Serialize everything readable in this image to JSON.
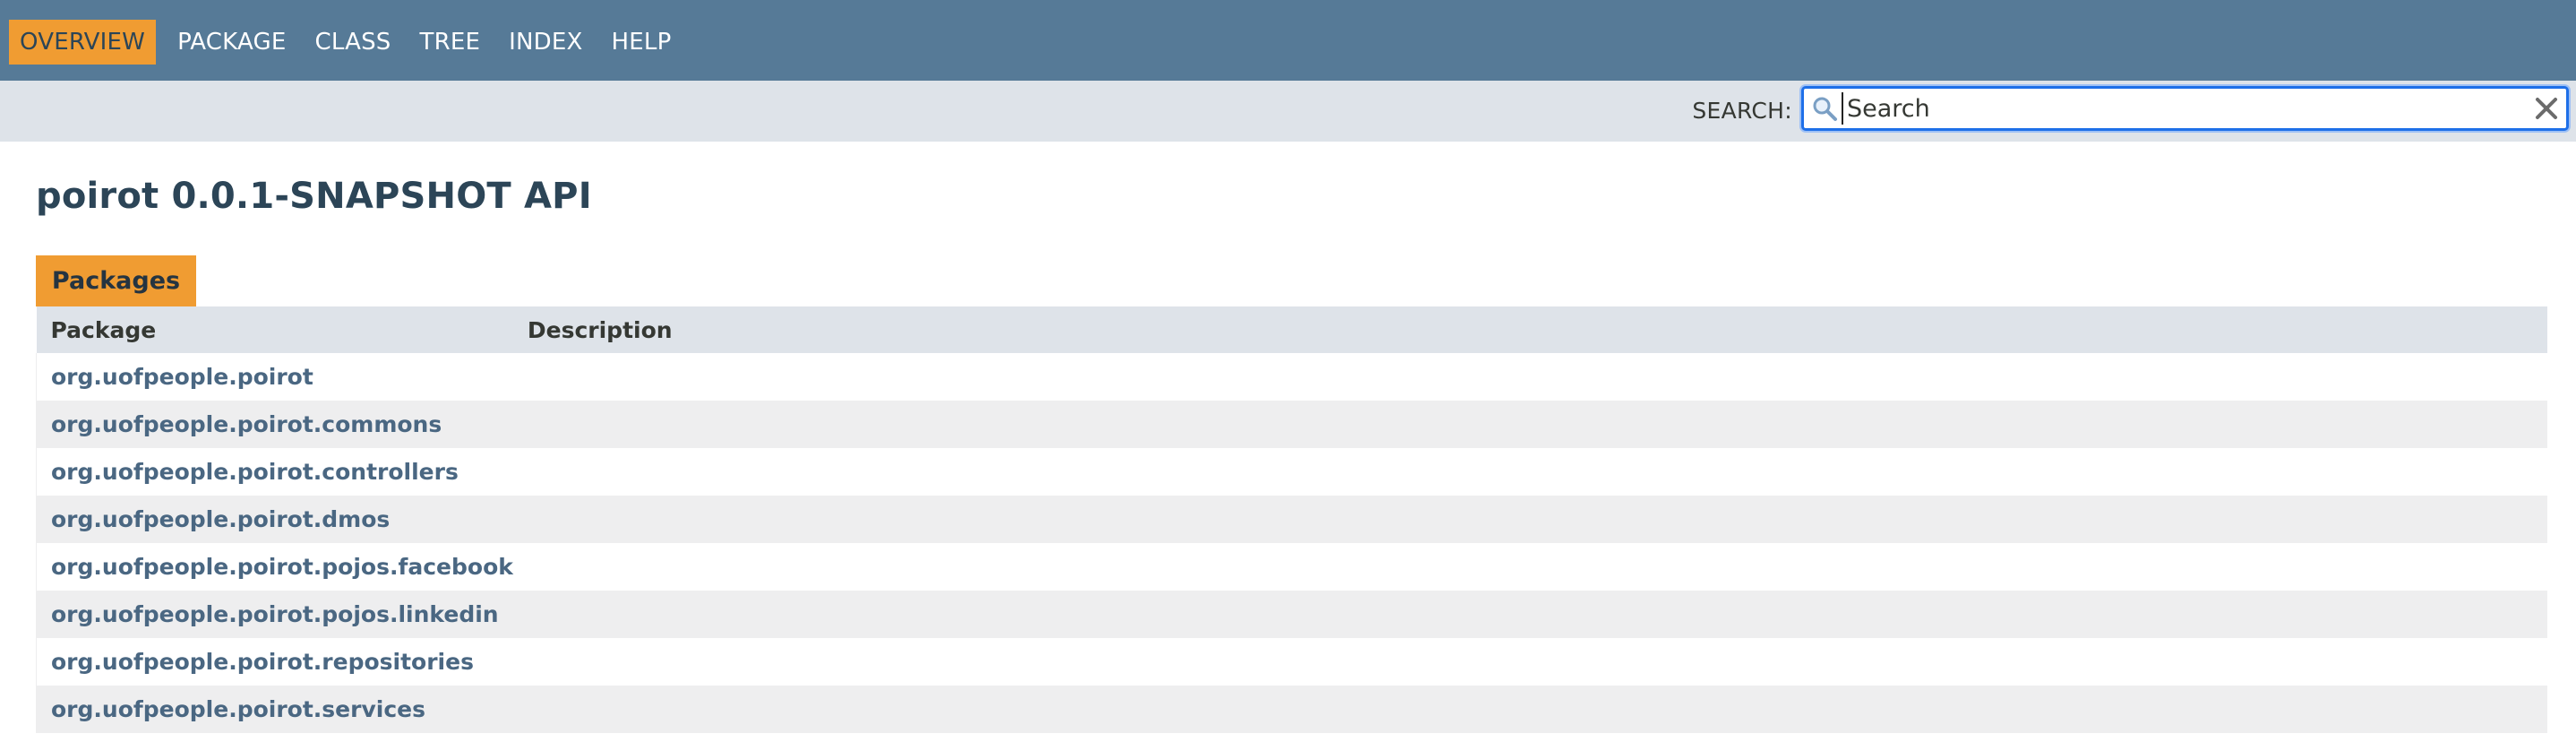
{
  "nav": {
    "items": [
      {
        "label": "OVERVIEW",
        "active": true
      },
      {
        "label": "PACKAGE",
        "active": false
      },
      {
        "label": "CLASS",
        "active": false
      },
      {
        "label": "TREE",
        "active": false
      },
      {
        "label": "INDEX",
        "active": false
      },
      {
        "label": "HELP",
        "active": false
      }
    ]
  },
  "search": {
    "label": "SEARCH:",
    "placeholder": "Search",
    "value": ""
  },
  "page": {
    "title": "poirot 0.0.1-SNAPSHOT API"
  },
  "packages": {
    "caption": "Packages",
    "headers": {
      "package": "Package",
      "description": "Description"
    },
    "rows": [
      {
        "name": "org.uofpeople.poirot",
        "description": ""
      },
      {
        "name": "org.uofpeople.poirot.commons",
        "description": ""
      },
      {
        "name": "org.uofpeople.poirot.controllers",
        "description": ""
      },
      {
        "name": "org.uofpeople.poirot.dmos",
        "description": ""
      },
      {
        "name": "org.uofpeople.poirot.pojos.facebook",
        "description": ""
      },
      {
        "name": "org.uofpeople.poirot.pojos.linkedin",
        "description": ""
      },
      {
        "name": "org.uofpeople.poirot.repositories",
        "description": ""
      },
      {
        "name": "org.uofpeople.poirot.services",
        "description": ""
      }
    ]
  },
  "colors": {
    "nav_bg": "#567a97",
    "accent": "#f09c32",
    "subnav_bg": "#dee3e9",
    "link": "#4a6782",
    "alt_row": "#eeeeef",
    "title": "#2c4557"
  },
  "icons": {
    "search": "search-icon",
    "reset": "close-icon"
  }
}
